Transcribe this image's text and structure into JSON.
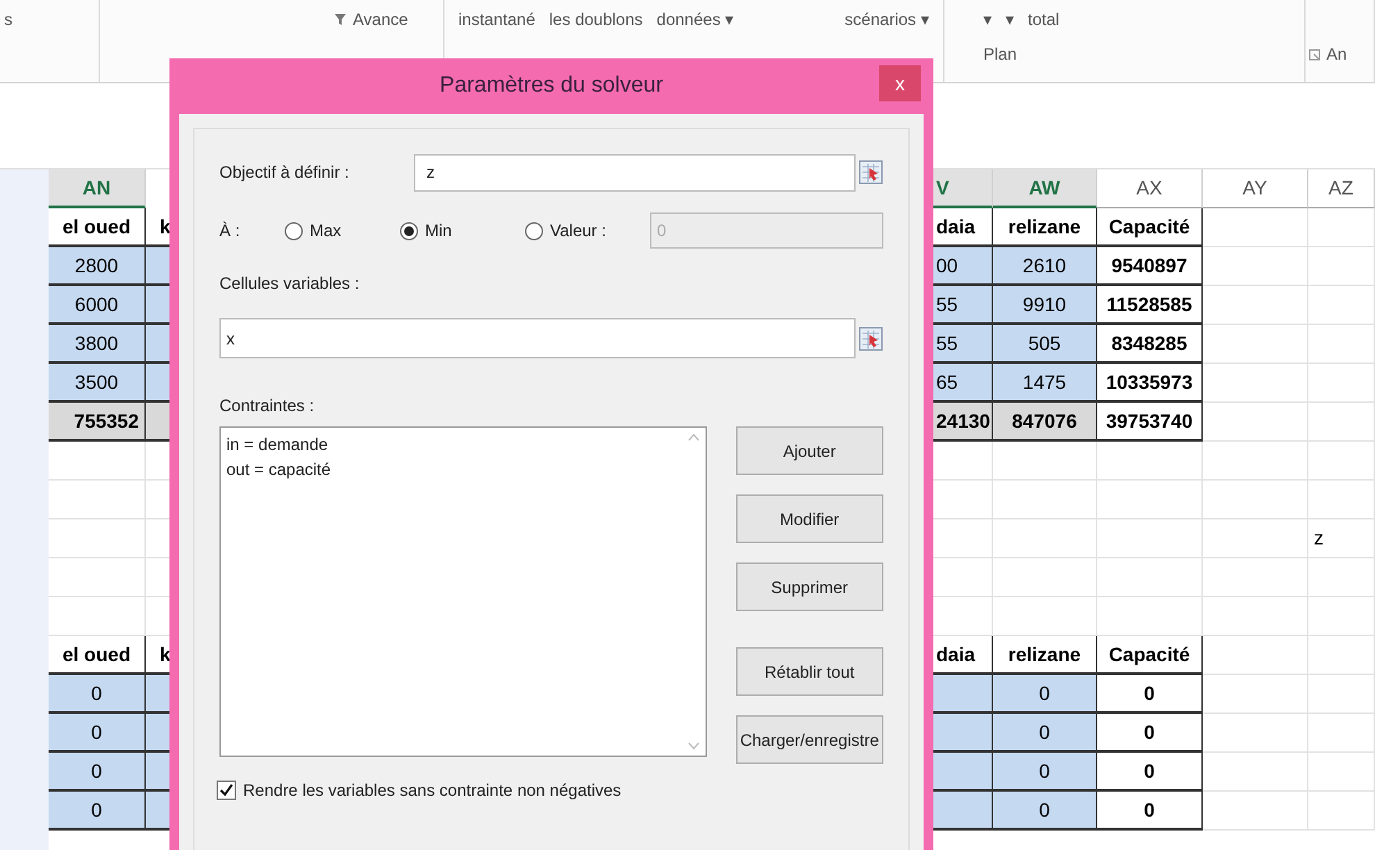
{
  "ribbon": {
    "groups": [
      {
        "items": [
          "s"
        ]
      },
      {
        "items": [
          "Avance"
        ]
      },
      {
        "items": [
          "instantané",
          "les doublons",
          "données ▾",
          "scénarios ▾"
        ]
      },
      {
        "items": [
          "▾",
          "▾",
          "total"
        ],
        "caption": "Plan"
      },
      {
        "caption": "An"
      }
    ]
  },
  "columns": [
    {
      "label": "AN",
      "selected": true
    },
    {
      "label": "V",
      "selected": true
    },
    {
      "label": "AW",
      "selected": true
    },
    {
      "label": "AX",
      "selected": false
    },
    {
      "label": "AY",
      "selected": false
    },
    {
      "label": "AZ",
      "selected": false
    }
  ],
  "rows": [
    {
      "kind": "header",
      "cells": {
        "an": "el oued",
        "mid": "k",
        "v": "daia",
        "aw": "relizane",
        "ax": "Capacité"
      }
    },
    {
      "kind": "data",
      "cells": {
        "an": "2800",
        "v": "00",
        "aw": "2610",
        "ax": "9540897"
      }
    },
    {
      "kind": "data",
      "cells": {
        "an": "6000",
        "v": "55",
        "aw": "9910",
        "ax": "11528585"
      }
    },
    {
      "kind": "data",
      "cells": {
        "an": "3800",
        "v": "55",
        "aw": "505",
        "ax": "8348285"
      }
    },
    {
      "kind": "data",
      "cells": {
        "an": "3500",
        "v": "65",
        "aw": "1475",
        "ax": "10335973"
      }
    },
    {
      "kind": "total",
      "cells": {
        "an": "755352",
        "v": "24130",
        "aw": "847076",
        "ax": "39753740"
      }
    },
    {
      "kind": "empty",
      "cells": {}
    },
    {
      "kind": "empty",
      "cells": {}
    },
    {
      "kind": "empty",
      "cells": {
        "az": "z"
      }
    },
    {
      "kind": "empty",
      "cells": {}
    },
    {
      "kind": "empty",
      "cells": {}
    },
    {
      "kind": "header",
      "cells": {
        "an": "el oued",
        "mid": "k",
        "v": "daia",
        "aw": "relizane",
        "ax": "Capacité"
      }
    },
    {
      "kind": "data",
      "cells": {
        "an": "0",
        "aw": "0",
        "ax": "0"
      }
    },
    {
      "kind": "data",
      "cells": {
        "an": "0",
        "aw": "0",
        "ax": "0"
      }
    },
    {
      "kind": "data",
      "cells": {
        "an": "0",
        "aw": "0",
        "ax": "0"
      }
    },
    {
      "kind": "data",
      "cells": {
        "an": "0",
        "aw": "0",
        "ax": "0"
      }
    }
  ],
  "dialog": {
    "title": "Paramètres du solveur",
    "close": "x",
    "objective": {
      "label": "Objectif à définir :",
      "value": "z"
    },
    "to": {
      "label": "À :",
      "options": [
        {
          "label": "Max",
          "selected": false
        },
        {
          "label": "Min",
          "selected": true
        },
        {
          "label": "Valeur :",
          "selected": false
        }
      ],
      "value_field": {
        "value": "0",
        "disabled": true
      }
    },
    "variables": {
      "label": "Cellules variables :",
      "value": "x"
    },
    "constraints": {
      "label": "Contraintes :",
      "items": [
        "in = demande",
        "out = capacité"
      ]
    },
    "buttons": [
      "Ajouter",
      "Modifier",
      "Supprimer",
      "Rétablir tout",
      "Charger/enregistre"
    ],
    "nonnegative": {
      "label": "Rendre les variables sans contrainte non négatives",
      "checked": true
    }
  }
}
